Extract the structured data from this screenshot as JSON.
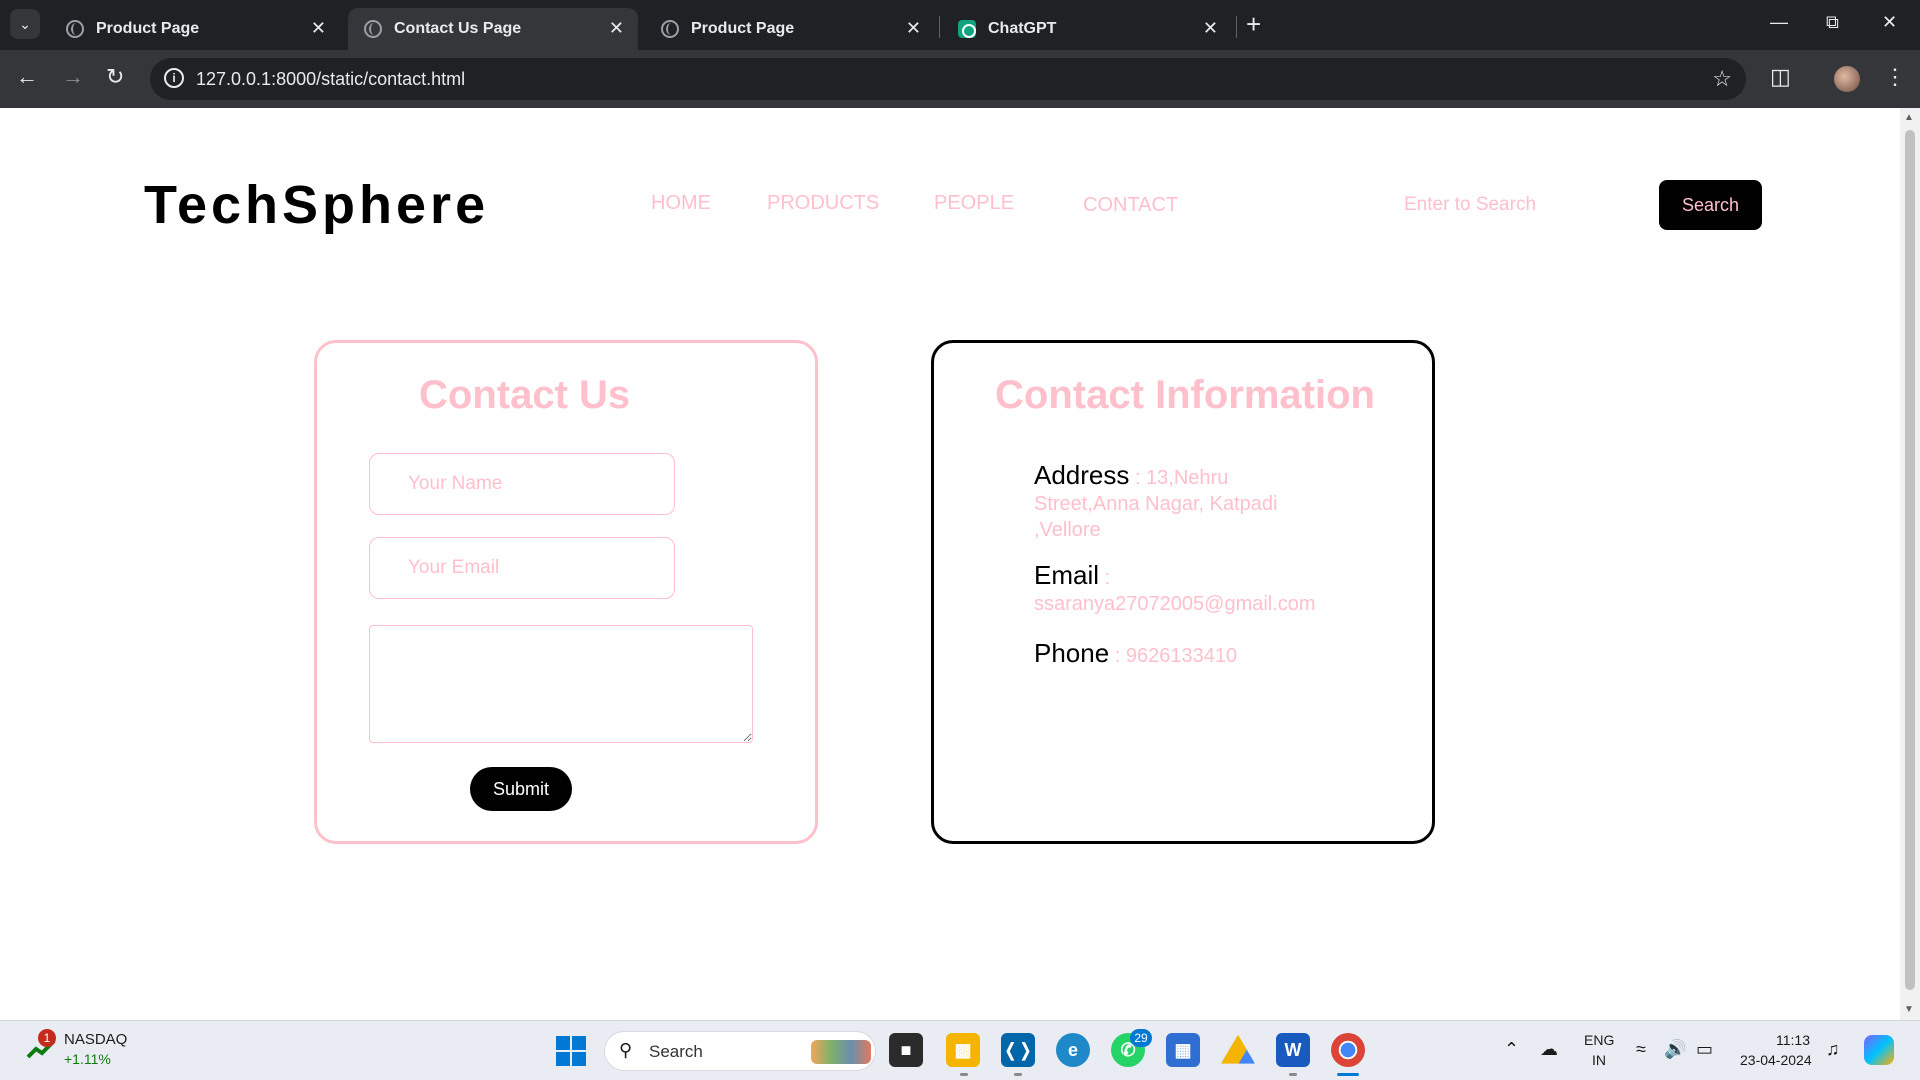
{
  "browser": {
    "tabs": [
      {
        "title": "Product Page",
        "active": false
      },
      {
        "title": "Contact Us Page",
        "active": true
      },
      {
        "title": "Product Page",
        "active": false
      },
      {
        "title": "ChatGPT",
        "active": false
      }
    ],
    "url": "127.0.0.1:8000/static/contact.html"
  },
  "site": {
    "logo": "TechSphere",
    "nav": [
      "HOME",
      "PRODUCTS",
      "PEOPLE",
      "CONTACT"
    ],
    "search_placeholder": "Enter to Search",
    "search_button": "Search"
  },
  "contact_form": {
    "title": "Contact Us",
    "name_placeholder": "Your Name",
    "email_placeholder": "Your Email",
    "submit_label": "Submit"
  },
  "contact_info": {
    "title": "Contact Information",
    "address_label": "Address",
    "address_value": " : 13,Nehru Street,Anna Nagar, Katpadi ,Vellore",
    "email_label": "Email",
    "email_value": " : ssaranya27072005@gmail.com",
    "phone_label": "Phone",
    "phone_value": " : 9626133410"
  },
  "colors": {
    "accent_pink": "#ffc0cb",
    "black": "#000000"
  },
  "taskbar": {
    "stock_badge": "1",
    "stock_name": "NASDAQ",
    "stock_change": "+1.11%",
    "search_label": "Search",
    "whatsapp_badge": "29",
    "lang_line1": "ENG",
    "lang_line2": "IN",
    "time": "11:13",
    "date": "23-04-2024"
  }
}
